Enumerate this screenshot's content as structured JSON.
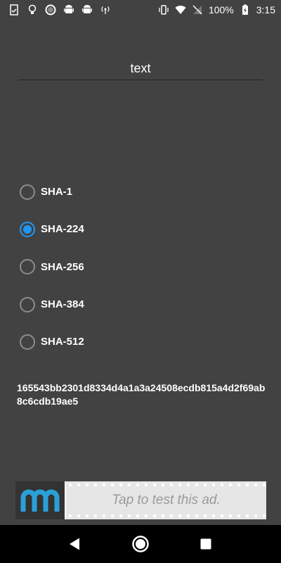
{
  "status_bar": {
    "icons_left": [
      "clipboard-check-icon",
      "lightbulb-icon",
      "circle-dot-icon",
      "android-icon",
      "android-icon",
      "broadcast-icon"
    ],
    "icons_right": [
      "vibrate-icon",
      "wifi-icon",
      "no-signal-icon",
      "battery-charging-icon"
    ],
    "battery": "100%",
    "time": "3:15"
  },
  "input": {
    "value": "text"
  },
  "algorithms": {
    "selected": "SHA-224",
    "options": [
      "SHA-1",
      "SHA-224",
      "SHA-256",
      "SHA-384",
      "SHA-512"
    ]
  },
  "hash": {
    "value": "165543bb2301d8334d4a1a3a24508ecdb815a4d2f69ab8c6cdb19ae5"
  },
  "ad": {
    "text": "Tap to test this ad.",
    "logo_color": "#2a9fd8"
  },
  "colors": {
    "background": "#424242",
    "accent": "#2196f3"
  }
}
